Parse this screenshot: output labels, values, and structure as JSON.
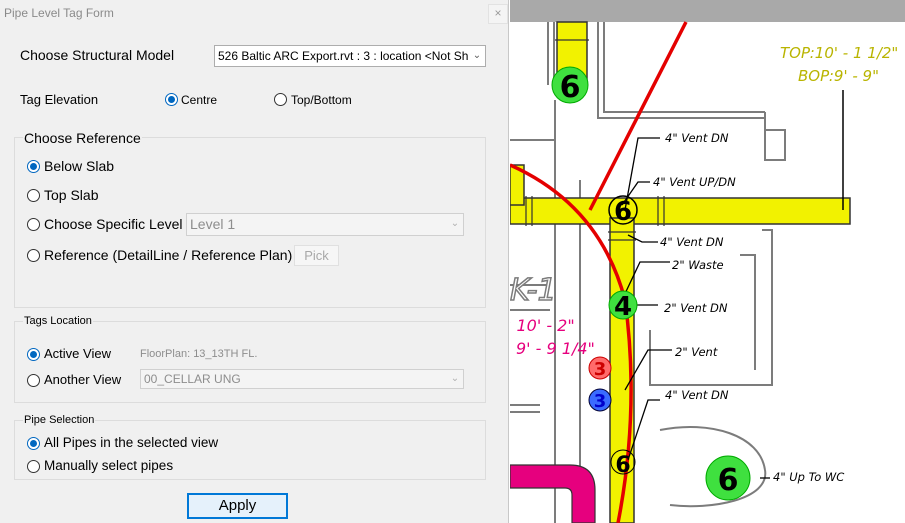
{
  "window": {
    "title": "Pipe Level Tag Form",
    "close_label": "×"
  },
  "structural_model": {
    "label": "Choose Structural Model",
    "value": "526 Baltic ARC Export.rvt : 3 : location <Not Shared>"
  },
  "tag_elevation": {
    "label": "Tag Elevation",
    "options": [
      {
        "label": "Centre",
        "selected": true
      },
      {
        "label": "Top/Bottom",
        "selected": false
      }
    ]
  },
  "reference": {
    "title": "Choose Reference",
    "below_slab": "Below Slab",
    "top_slab": "Top Slab",
    "specific_level": "Choose Specific Level",
    "specific_level_value": "Level 1",
    "detail_line": "Reference (DetailLine / Reference Plan)",
    "pick_label": "Pick",
    "selected": "Below Slab"
  },
  "tags_location": {
    "title": "Tags Location",
    "active_view": "Active View",
    "active_view_name": "FloorPlan: 13_13TH FL.",
    "another_view": "Another View",
    "another_view_value": "00_CELLAR UNG",
    "selected": "Active View"
  },
  "pipe_selection": {
    "title": "Pipe Selection",
    "all_pipes": "All Pipes in the selected view",
    "manual": "Manually select pipes",
    "selected": "All Pipes in the selected view"
  },
  "apply_label": "Apply",
  "drawing": {
    "level_annotation": [
      "TOP:10' - 1 1/2\"",
      "BOP:9' - 9\""
    ],
    "pink_annotation": [
      ": 10' - 2\"",
      "9' - 9 1/4\""
    ],
    "grid_label": "K-1",
    "tag_numbers": [
      "6",
      "6",
      "4",
      "6",
      "3",
      "3",
      "6"
    ],
    "pipe_labels": [
      "4\" Vent DN",
      "4\" Vent UP/DN",
      "4\" Vent DN",
      "2\" Waste",
      "2\" Vent DN",
      "2\" Vent",
      "4\" Vent DN",
      "4\" Up To WC"
    ],
    "colors": {
      "pipe": "#f2f200",
      "cut_line": "#e40000",
      "annotation": "#b9b400",
      "magenta": "#e6007e"
    }
  }
}
